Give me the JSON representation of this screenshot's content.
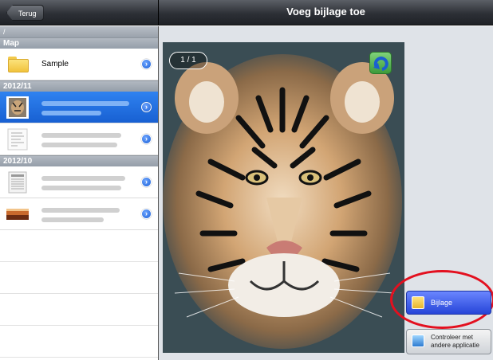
{
  "header": {
    "back_label": "Terug",
    "title": "Voeg bijlage toe"
  },
  "sidebar": {
    "path": "/",
    "sections": [
      {
        "label": "Map"
      },
      {
        "label": "2012/11"
      },
      {
        "label": "2012/10"
      }
    ],
    "folder": {
      "label": "Sample"
    }
  },
  "preview": {
    "page_indicator": "1 / 1"
  },
  "actions": {
    "attach_label": "Bijlage",
    "other_app_label": "Controleer met andere applicatie"
  },
  "colors": {
    "accent": "#1860d2",
    "highlight": "#e3101f"
  }
}
